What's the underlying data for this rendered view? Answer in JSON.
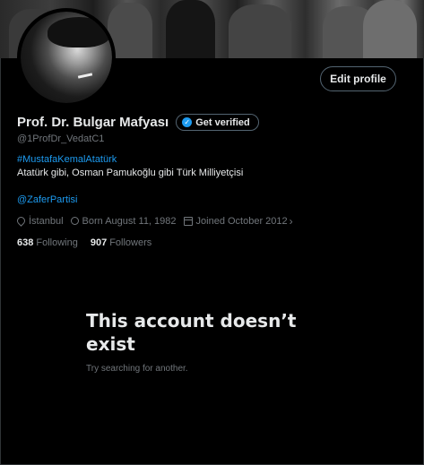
{
  "profile": {
    "name": "Prof. Dr. Bulgar Mafyası",
    "handle": "@1ProfDr_VedatC1",
    "hashtag": "#MustafaKemalAtatürk",
    "bio": "Atatürk gibi, Osman Pamukoğlu gibi Türk Milliyetçisi",
    "mention": "@ZaferPartisi",
    "location": "İstanbul",
    "born": "Born August 11, 1982",
    "joined": "Joined October 2012",
    "following_count": "638",
    "following_label": "Following",
    "followers_count": "907",
    "followers_label": "Followers"
  },
  "buttons": {
    "edit_profile": "Edit profile",
    "get_verified": "Get verified"
  },
  "empty_state": {
    "title": "This account doesn’t exist",
    "subtitle": "Try searching for another."
  },
  "colors": {
    "background": "#000000",
    "accent": "#1d9bf0",
    "text_primary": "#e7e9ea",
    "text_secondary": "#71767b",
    "border": "#536471"
  },
  "icons": {
    "location": "location-pin-icon",
    "birthday": "balloon-icon",
    "joined": "calendar-icon",
    "verified": "verified-badge-icon"
  }
}
